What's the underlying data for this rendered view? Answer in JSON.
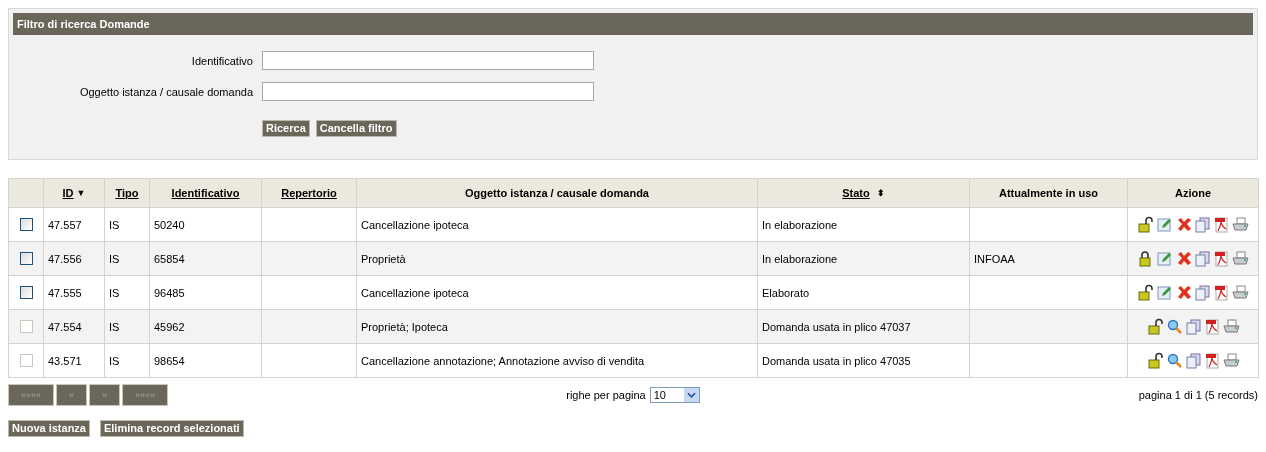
{
  "filter": {
    "title": "Filtro di ricerca Domande",
    "fields": [
      {
        "label": "Identificativo"
      },
      {
        "label": "Oggetto istanza / causale domanda"
      }
    ],
    "buttons": [
      "Ricerca",
      "Cancella filtro"
    ]
  },
  "table": {
    "columns": [
      {
        "label": "ID",
        "sortable": true,
        "sort_icon": "▼"
      },
      {
        "label": "Tipo",
        "sortable": true
      },
      {
        "label": "Identificativo",
        "sortable": true
      },
      {
        "label": "Repertorio",
        "sortable": true
      },
      {
        "label": "Oggetto istanza / causale domanda",
        "sortable": false
      },
      {
        "label": "Stato",
        "sortable": true,
        "sort_icon": "⬍"
      },
      {
        "label": "Attualmente in uso",
        "sortable": false
      },
      {
        "label": "Azione",
        "sortable": false
      }
    ],
    "rows": [
      {
        "checkbox_disabled": false,
        "checked": false,
        "cells": [
          "47.557",
          "IS",
          "50240",
          "",
          "Cancellazione ipoteca",
          "In elaborazione",
          ""
        ],
        "locked": false,
        "actions": [
          {
            "kind": "lock"
          },
          {
            "kind": "edit"
          },
          {
            "kind": "delete"
          },
          {
            "kind": "copy"
          },
          {
            "kind": "pdf"
          },
          {
            "kind": "print"
          }
        ]
      },
      {
        "checkbox_disabled": false,
        "checked": false,
        "cells": [
          "47.556",
          "IS",
          "65854",
          "",
          "Proprietà",
          "In elaborazione",
          "INFOAA"
        ],
        "locked": true,
        "actions": [
          {
            "kind": "lock"
          },
          {
            "kind": "edit"
          },
          {
            "kind": "delete"
          },
          {
            "kind": "copy"
          },
          {
            "kind": "pdf"
          },
          {
            "kind": "print"
          }
        ]
      },
      {
        "checkbox_disabled": false,
        "checked": false,
        "cells": [
          "47.555",
          "IS",
          "96485",
          "",
          "Cancellazione ipoteca",
          "Elaborato",
          ""
        ],
        "locked": false,
        "actions": [
          {
            "kind": "lock"
          },
          {
            "kind": "edit"
          },
          {
            "kind": "delete"
          },
          {
            "kind": "copy"
          },
          {
            "kind": "pdf"
          },
          {
            "kind": "print"
          }
        ]
      },
      {
        "checkbox_disabled": true,
        "checked": false,
        "cells": [
          "47.554",
          "IS",
          "45962",
          "",
          "Proprietà; Ipoteca",
          "Domanda usata in plico 47037",
          ""
        ],
        "locked": false,
        "actions": [
          {
            "kind": "lock"
          },
          {
            "kind": "view"
          },
          {
            "kind": "copy"
          },
          {
            "kind": "pdf"
          },
          {
            "kind": "print"
          }
        ]
      },
      {
        "checkbox_disabled": true,
        "checked": false,
        "cells": [
          "43.571",
          "IS",
          "98654",
          "",
          "Cancellazione annotazione; Annotazione avviso di vendita",
          "Domanda usata in plico 47035",
          ""
        ],
        "locked": false,
        "actions": [
          {
            "kind": "lock"
          },
          {
            "kind": "view"
          },
          {
            "kind": "copy"
          },
          {
            "kind": "pdf"
          },
          {
            "kind": "print"
          }
        ]
      }
    ]
  },
  "pager": {
    "buttons": [
      {
        "label": "««««",
        "disabled": true
      },
      {
        "label": "«",
        "disabled": true
      },
      {
        "label": "»",
        "disabled": true
      },
      {
        "label": "»»»»",
        "disabled": true
      }
    ],
    "rows_label": "righe per pagina",
    "rows_value": "10",
    "info": "pagina 1 di 1 (5 records)"
  },
  "actions": [
    "Nuova istanza",
    "Elimina record selezionati"
  ]
}
